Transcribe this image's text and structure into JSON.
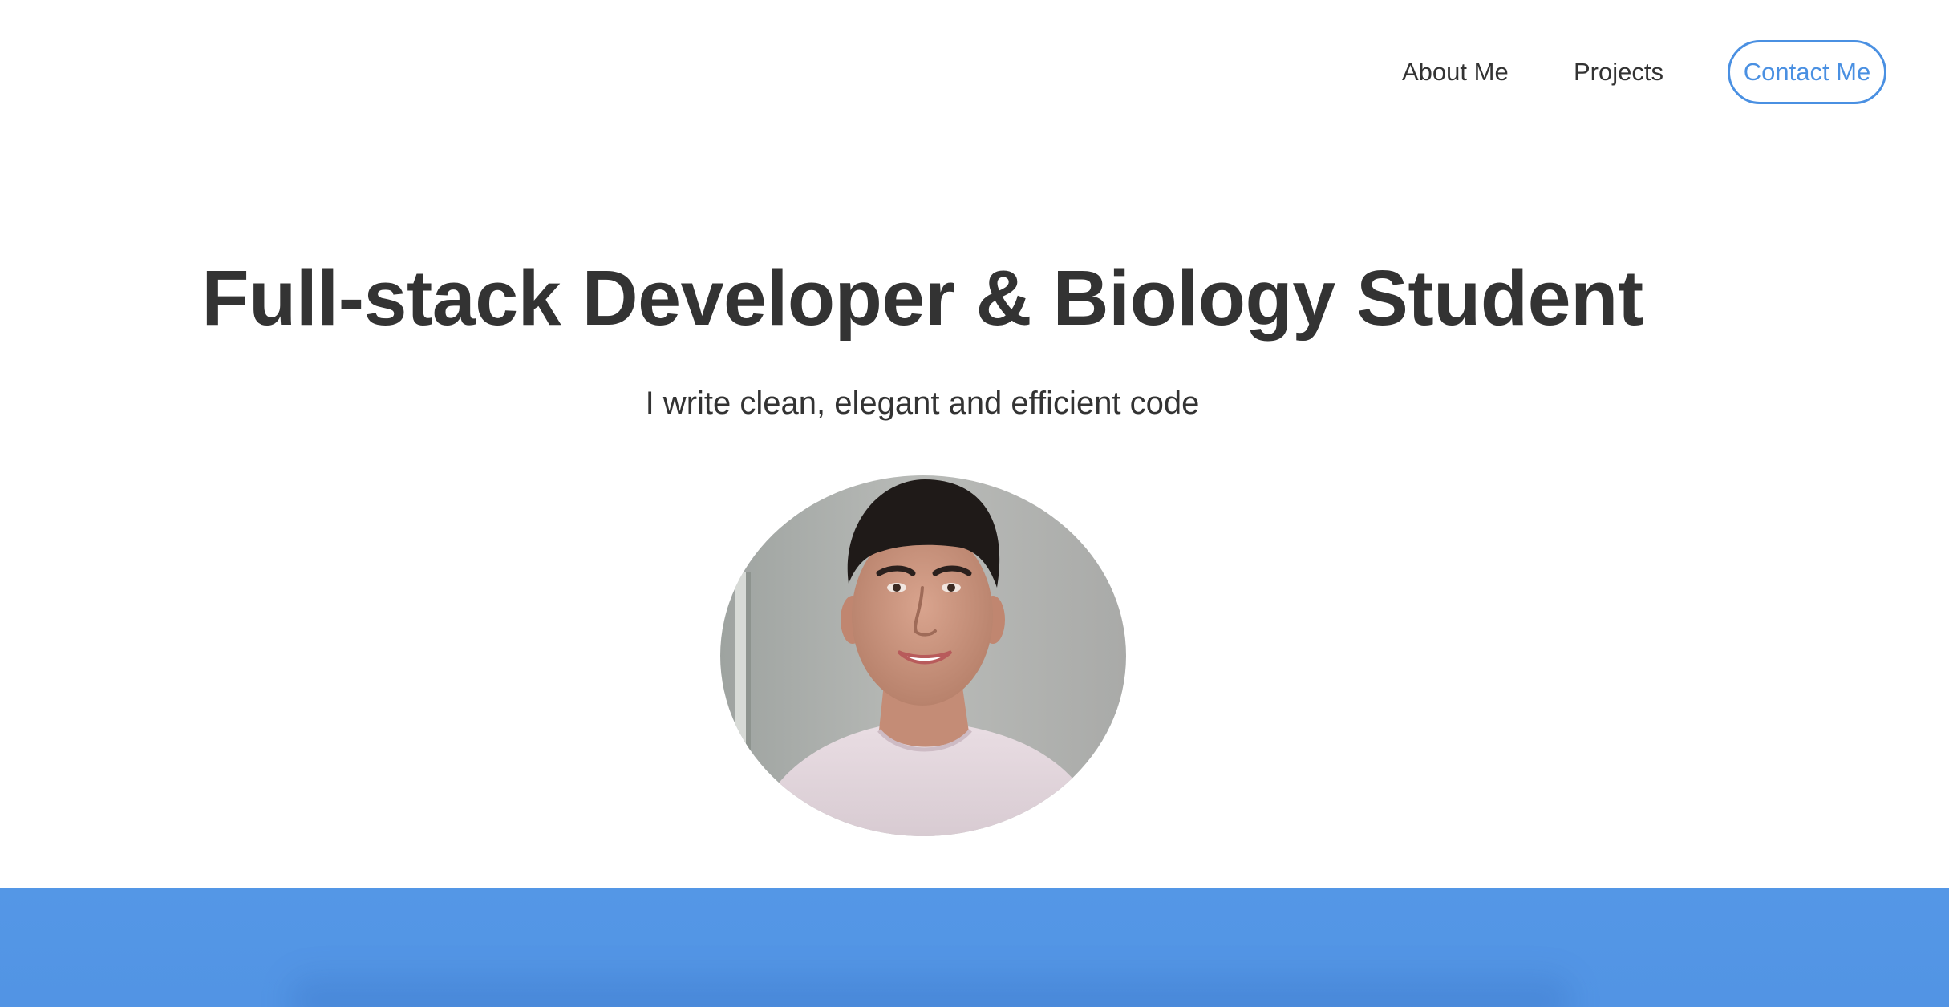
{
  "nav": {
    "about_label": "About Me",
    "projects_label": "Projects",
    "contact_label": "Contact Me"
  },
  "hero": {
    "title": "Full-stack Developer & Biology Student",
    "subtitle": "I write clean, elegant and efficient code"
  },
  "colors": {
    "accent": "#4a90e2",
    "text": "#333333",
    "band": "#5294e4",
    "background": "#ffffff"
  }
}
